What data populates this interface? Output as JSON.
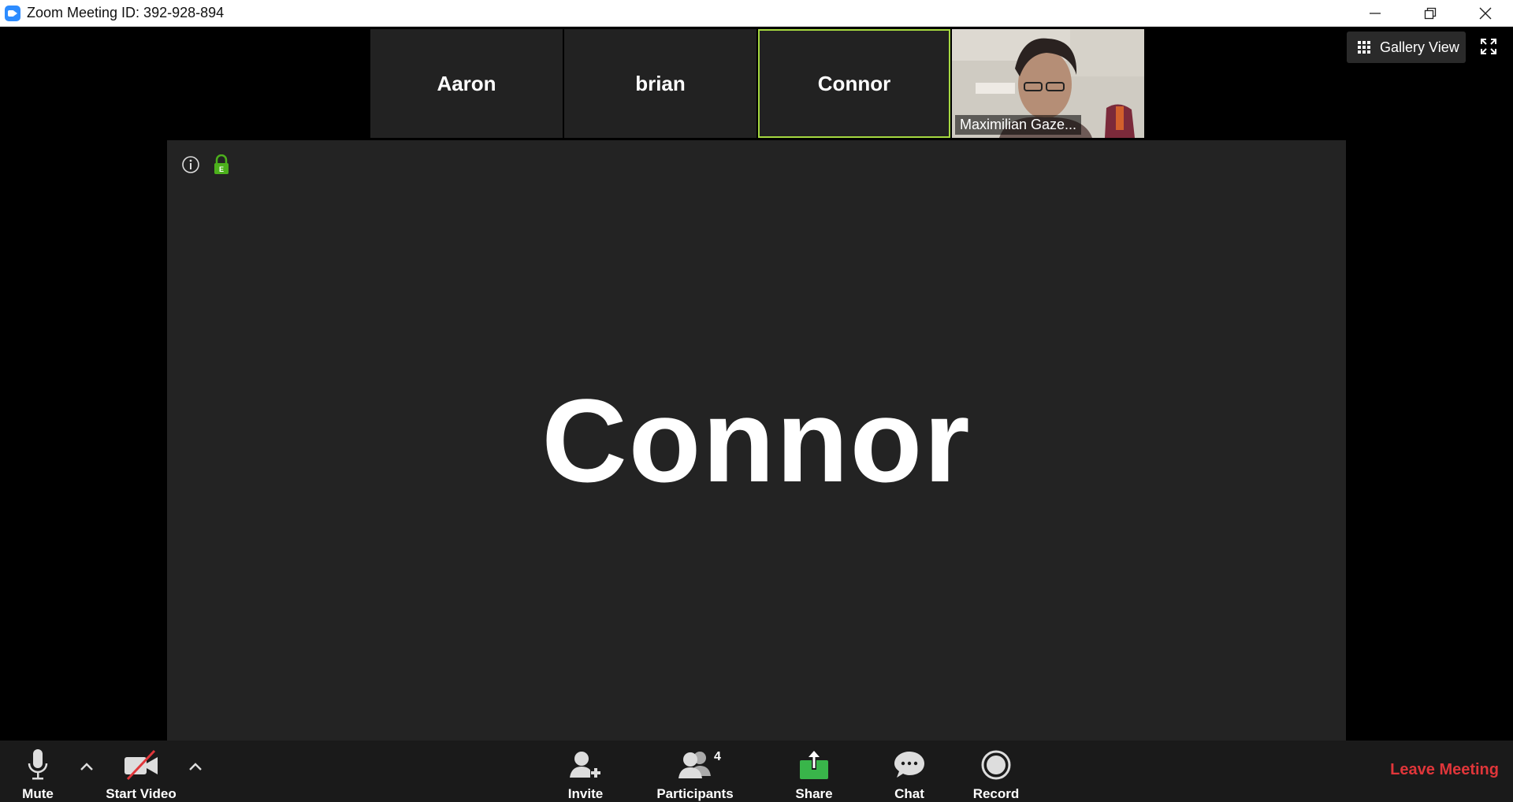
{
  "window": {
    "title": "Zoom Meeting ID: 392-928-894"
  },
  "participants_strip": [
    {
      "name": "Aaron",
      "active": false,
      "video": false
    },
    {
      "name": "brian",
      "active": false,
      "video": false
    },
    {
      "name": "Connor",
      "active": true,
      "video": false
    },
    {
      "name": "Maximilian Gaze...",
      "active": false,
      "video": true
    }
  ],
  "view": {
    "gallery_label": "Gallery View"
  },
  "stage": {
    "speaker_name": "Connor",
    "encryption_badge": "E"
  },
  "toolbar": {
    "mute_label": "Mute",
    "video_label": "Start Video",
    "invite_label": "Invite",
    "participants_label": "Participants",
    "participants_count": "4",
    "share_label": "Share",
    "chat_label": "Chat",
    "record_label": "Record",
    "leave_label": "Leave Meeting"
  },
  "colors": {
    "active_border": "#a6d940",
    "share_green": "#39b54a",
    "leave_red": "#e0363a",
    "lock_green": "#4cb01c"
  }
}
